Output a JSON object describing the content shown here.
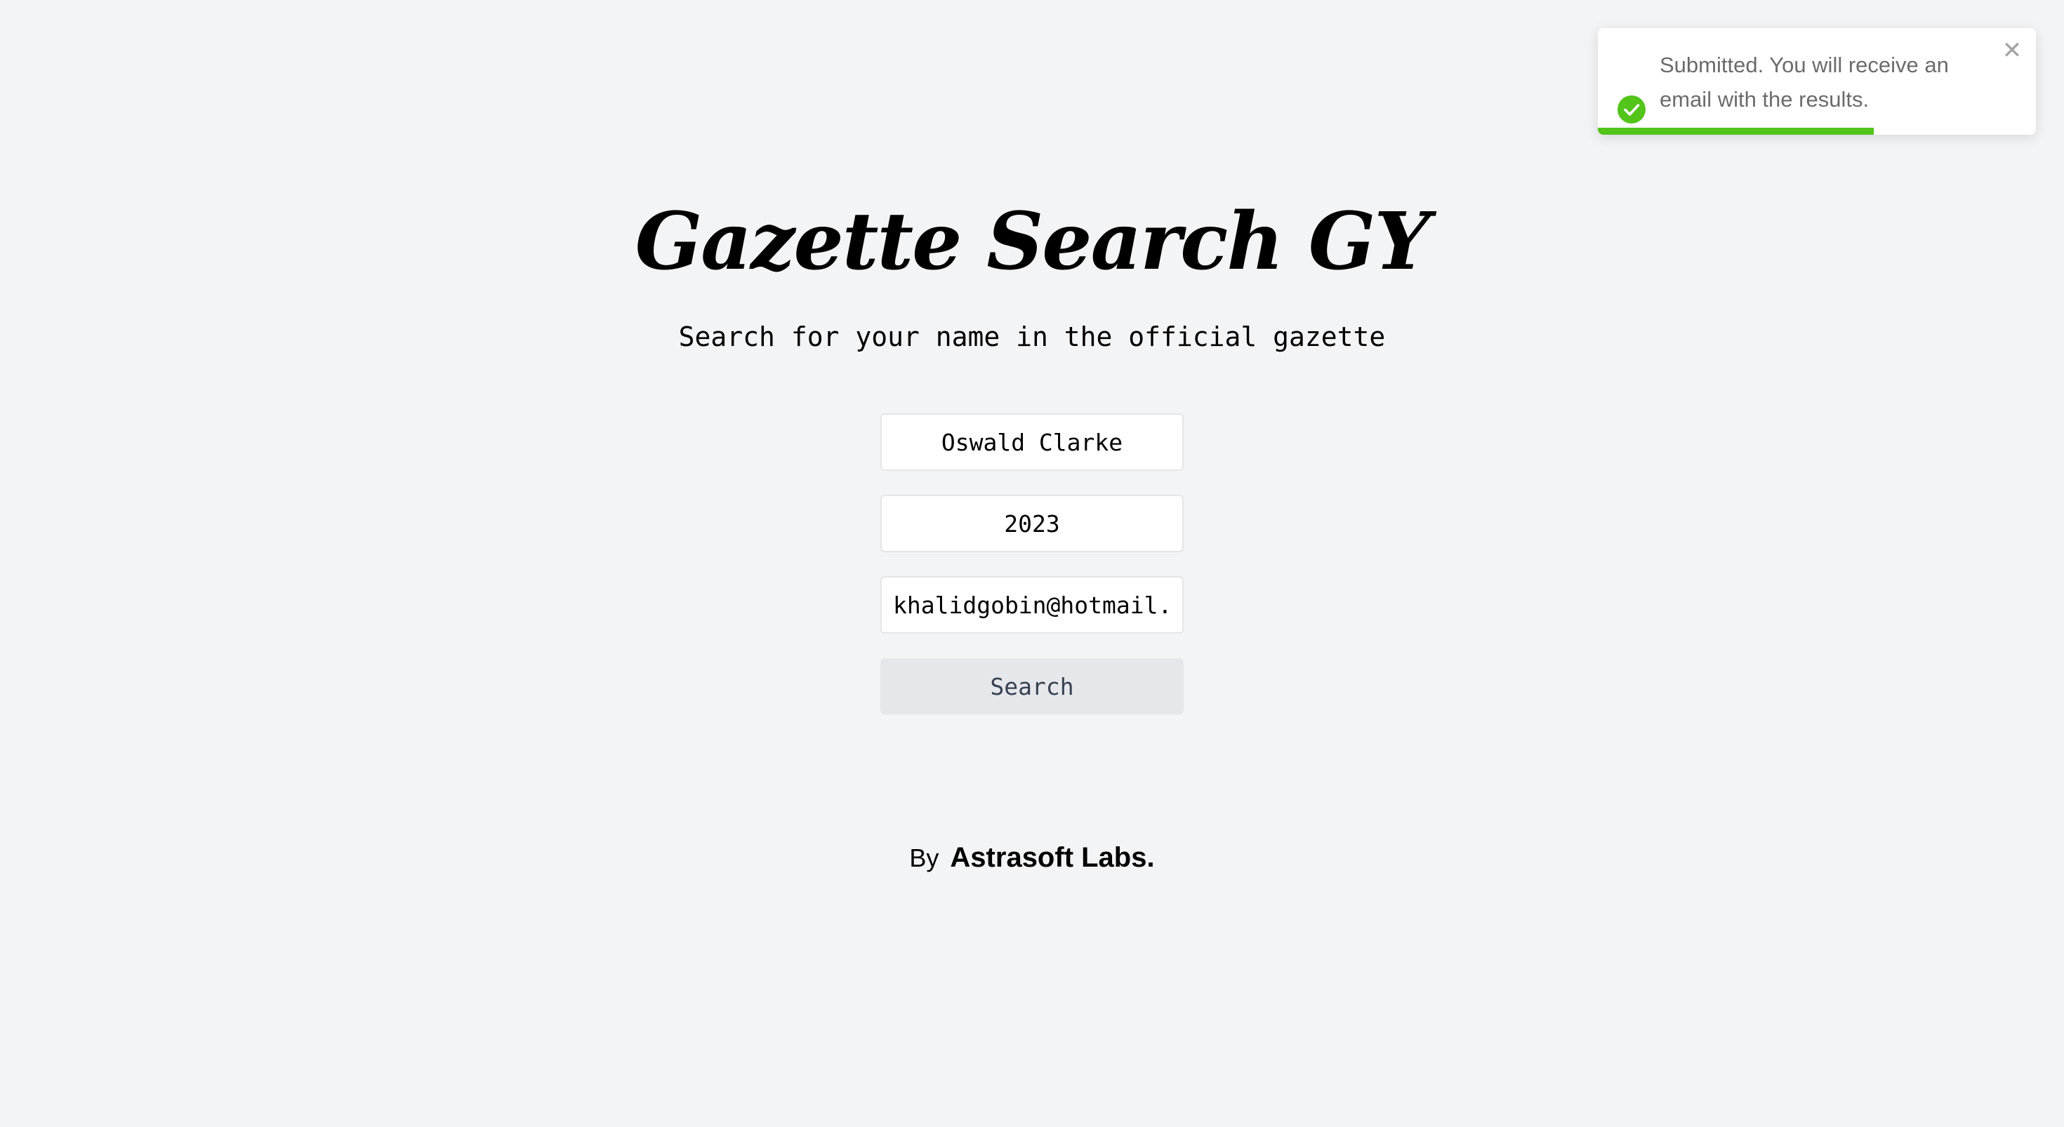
{
  "header": {
    "title": "Gazette Search GY",
    "subtitle": "Search for your name in the official gazette"
  },
  "form": {
    "name_value": "Oswald Clarke",
    "year_value": "2023",
    "email_value": "khalidgobin@hotmail.c",
    "search_label": "Search"
  },
  "footer": {
    "by_label": "By",
    "brand": "Astrasoft Labs."
  },
  "toast": {
    "message": "Submitted. You will receive an email with the results.",
    "icon": "check-circle-icon",
    "close_icon": "close-icon",
    "close_glyph": "✕",
    "progress_fraction": 0.63,
    "color": "#52c41a"
  }
}
